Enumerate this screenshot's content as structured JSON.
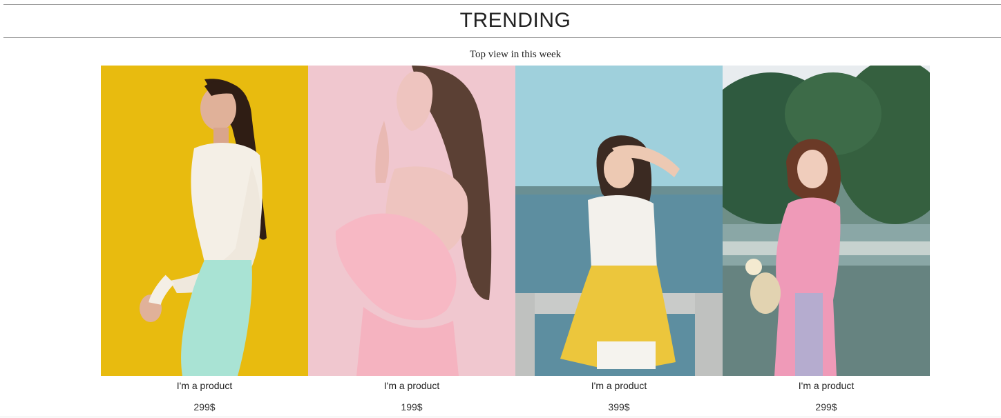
{
  "section": {
    "title": "TRENDING",
    "subtitle": "Top view in this week"
  },
  "products": [
    {
      "name": "I'm a product",
      "price": "299$",
      "photo": {
        "background": "#e6b90c",
        "skin": "#e0b199",
        "hair": "#2f1d14",
        "top": "#f4efe6",
        "bottom": "#a9e3d4"
      }
    },
    {
      "name": "I'm a product",
      "price": "199$",
      "photo": {
        "background": "#f0c7cf",
        "skin": "#eec4bf",
        "hair": "#5b4034",
        "dress": "#f7b8c4"
      }
    },
    {
      "name": "I'm a product",
      "price": "399$",
      "photo": {
        "sky": "#9fd0dc",
        "water": "#5d8ea0",
        "skin": "#edc9b3",
        "hair": "#3b2a22",
        "top": "#f3f1ec",
        "skirt": "#ecc63c"
      }
    },
    {
      "name": "I'm a product",
      "price": "299$",
      "photo": {
        "trees": "#2f5a3f",
        "water": "#8aa7a6",
        "skin": "#f0cdbc",
        "hair": "#6b3a27",
        "dress": "#ef9ab8"
      }
    }
  ]
}
